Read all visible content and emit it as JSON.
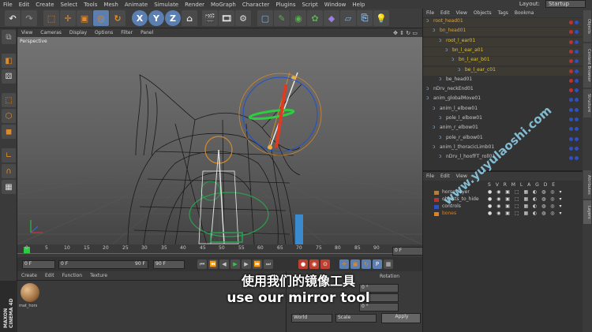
{
  "menu": [
    "File",
    "Edit",
    "Create",
    "Select",
    "Tools",
    "Mesh",
    "Animate",
    "Simulate",
    "Render",
    "MoGraph",
    "Character",
    "Plugins",
    "Script",
    "Window",
    "Help"
  ],
  "layout": {
    "label": "Layout:",
    "value": "Startup"
  },
  "toolbar": {
    "x": "X",
    "y": "Y",
    "z": "Z"
  },
  "viewport_menu": [
    "View",
    "Cameras",
    "Display",
    "Options",
    "Filter",
    "Panel"
  ],
  "viewport": {
    "label": "Perspective"
  },
  "timeline": {
    "ticks": [
      "0",
      "5",
      "10",
      "15",
      "20",
      "25",
      "30",
      "35",
      "40",
      "45",
      "50",
      "55",
      "60",
      "65",
      "70",
      "75",
      "80",
      "85",
      "90"
    ],
    "end": "0 F"
  },
  "transport": {
    "start": "0 F",
    "min": "0 F",
    "max": "90 F",
    "end": "90 F"
  },
  "material_menu": [
    "Create",
    "Edit",
    "Function",
    "Texture"
  ],
  "material": {
    "name": "mat_hors"
  },
  "coords": {
    "header": "Rotation",
    "h": "0 °",
    "p": "0 °",
    "b": "0 °",
    "world": "World",
    "scale": "Scale",
    "apply": "Apply"
  },
  "objects_menu": [
    "File",
    "Edit",
    "View",
    "Objects",
    "Tags",
    "Bookma"
  ],
  "objects": [
    {
      "label": "root_head01",
      "color": "#e0a030",
      "indent": 4
    },
    {
      "label": "bn_head01",
      "color": "#e0a030",
      "indent": 12
    },
    {
      "label": "root_l_ear01",
      "color": "#e0c030",
      "indent": 20
    },
    {
      "label": "bn_l_ear_a01",
      "color": "#e0c030",
      "indent": 28
    },
    {
      "label": "bn_l_ear_b01",
      "color": "#e0c030",
      "indent": 36
    },
    {
      "label": "be_l_ear_c01",
      "color": "#e0c030",
      "indent": 44
    },
    {
      "label": "be_head01",
      "color": "#c8c8c8",
      "indent": 20
    },
    {
      "label": "nDrv_neckEnd01",
      "color": "#c8c8c8",
      "indent": 4
    },
    {
      "label": "anim_globalMove01",
      "color": "#c8c8c8",
      "indent": 4
    },
    {
      "label": "anim_l_elbow01",
      "color": "#c8c8c8",
      "indent": 12
    },
    {
      "label": "pole_l_elbow01",
      "color": "#c8c8c8",
      "indent": 20
    },
    {
      "label": "anim_r_elbow01",
      "color": "#c8c8c8",
      "indent": 12
    },
    {
      "label": "pole_r_elbow01",
      "color": "#c8c8c8",
      "indent": 20
    },
    {
      "label": "anim_l_thoracicLimb01",
      "color": "#c8c8c8",
      "indent": 12
    },
    {
      "label": "nDrv_l_hoofFT_roll01",
      "color": "#c8c8c8",
      "indent": 20
    }
  ],
  "layers_menu": [
    "File",
    "Edit",
    "View"
  ],
  "layers_header": "S V R M L A G D E",
  "layers": [
    {
      "label": "horse_layer",
      "swatch": "#b08040",
      "color": "#c8c8c8"
    },
    {
      "label": "objects_to_hide",
      "swatch": "#c03030",
      "color": "#c8c8c8"
    },
    {
      "label": "controls",
      "swatch": "#3050c0",
      "color": "#c8c8c8"
    },
    {
      "label": "bones",
      "swatch": "#e08020",
      "color": "#e08020"
    }
  ],
  "side_tabs": [
    "Objects",
    "Content Browser",
    "Structure",
    "Attributes",
    "Layers"
  ],
  "subtitle": {
    "cn": "使用我们的镜像工具",
    "en": "use our mirror tool"
  },
  "watermark": "www.yuyulaoshi.com",
  "brand": {
    "maxon": "MAXON",
    "cinema": "CINEMA 4D"
  }
}
